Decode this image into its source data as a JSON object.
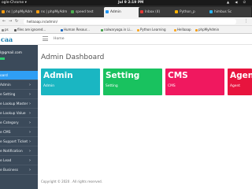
{
  "os_bar": {
    "app": "ogle-Chrome ▾",
    "clock": "Jul 9  2:19 PM"
  },
  "tabs": [
    {
      "label": "ns | phpMyAdm",
      "color": "#f39c12"
    },
    {
      "label": "ns | phpMyAdm",
      "color": "#f39c12"
    },
    {
      "label": "speed test",
      "color": "#4caf50"
    },
    {
      "label": "Admin",
      "color": "#2196f3",
      "active": true
    },
    {
      "label": "Inbox (4)",
      "color": "#e53935"
    },
    {
      "label": "Python_p",
      "color": "#ffb300"
    },
    {
      "label": "himbus Sc",
      "color": "#29b6f6"
    }
  ],
  "address": {
    "url": "hellaaap.in/admin/",
    "back": "←",
    "forward": "→",
    "reload": "↻",
    "menu": "⋮"
  },
  "bookmarks": [
    {
      "label": "ps",
      "color": "#888"
    },
    {
      "label": "files are ignored...",
      "color": "#555"
    },
    {
      "label": "Human Resour...",
      "color": "#1565c0"
    },
    {
      "label": "nalwaryoga.in Li...",
      "color": "#43a047"
    },
    {
      "label": "Python Learning",
      "color": "#f9a825"
    },
    {
      "label": "Hellaaap",
      "color": "#f9a825"
    },
    {
      "label": "phpMyAdmin",
      "color": "#f39c12"
    }
  ],
  "sidebar": {
    "logo": "caa",
    "user_email": "l@gmail.com",
    "items": [
      {
        "label": "oard",
        "active": true,
        "chevron": ""
      },
      {
        "label": "Admin",
        "chevron": "›"
      },
      {
        "label": "e Setting",
        "chevron": "›"
      },
      {
        "label": "e Lookup Master",
        "chevron": "›"
      },
      {
        "label": "e Lookup Value",
        "chevron": "›"
      },
      {
        "label": "e Category",
        "chevron": "›"
      },
      {
        "label": "e CMS",
        "chevron": "›"
      },
      {
        "label": "e Support Ticket",
        "chevron": "›"
      },
      {
        "label": "e Notification",
        "chevron": "›"
      },
      {
        "label": "e Lead",
        "chevron": "›"
      },
      {
        "label": "e Business",
        "chevron": "›"
      }
    ]
  },
  "header": {
    "home": "Home"
  },
  "page_title": "Admin Dashboard",
  "cards": [
    {
      "title": "Admin",
      "subtitle": "Admin",
      "color": "#1ab6c2"
    },
    {
      "title": "Setting",
      "subtitle": "Setting",
      "color": "#19c25f"
    },
    {
      "title": "CMS",
      "subtitle": "CMS",
      "color": "#f0185f"
    },
    {
      "title": "Agent",
      "subtitle": "Agent",
      "color": "#e8143e"
    }
  ],
  "footer": "Copyright © 2020 . All rights reserved."
}
